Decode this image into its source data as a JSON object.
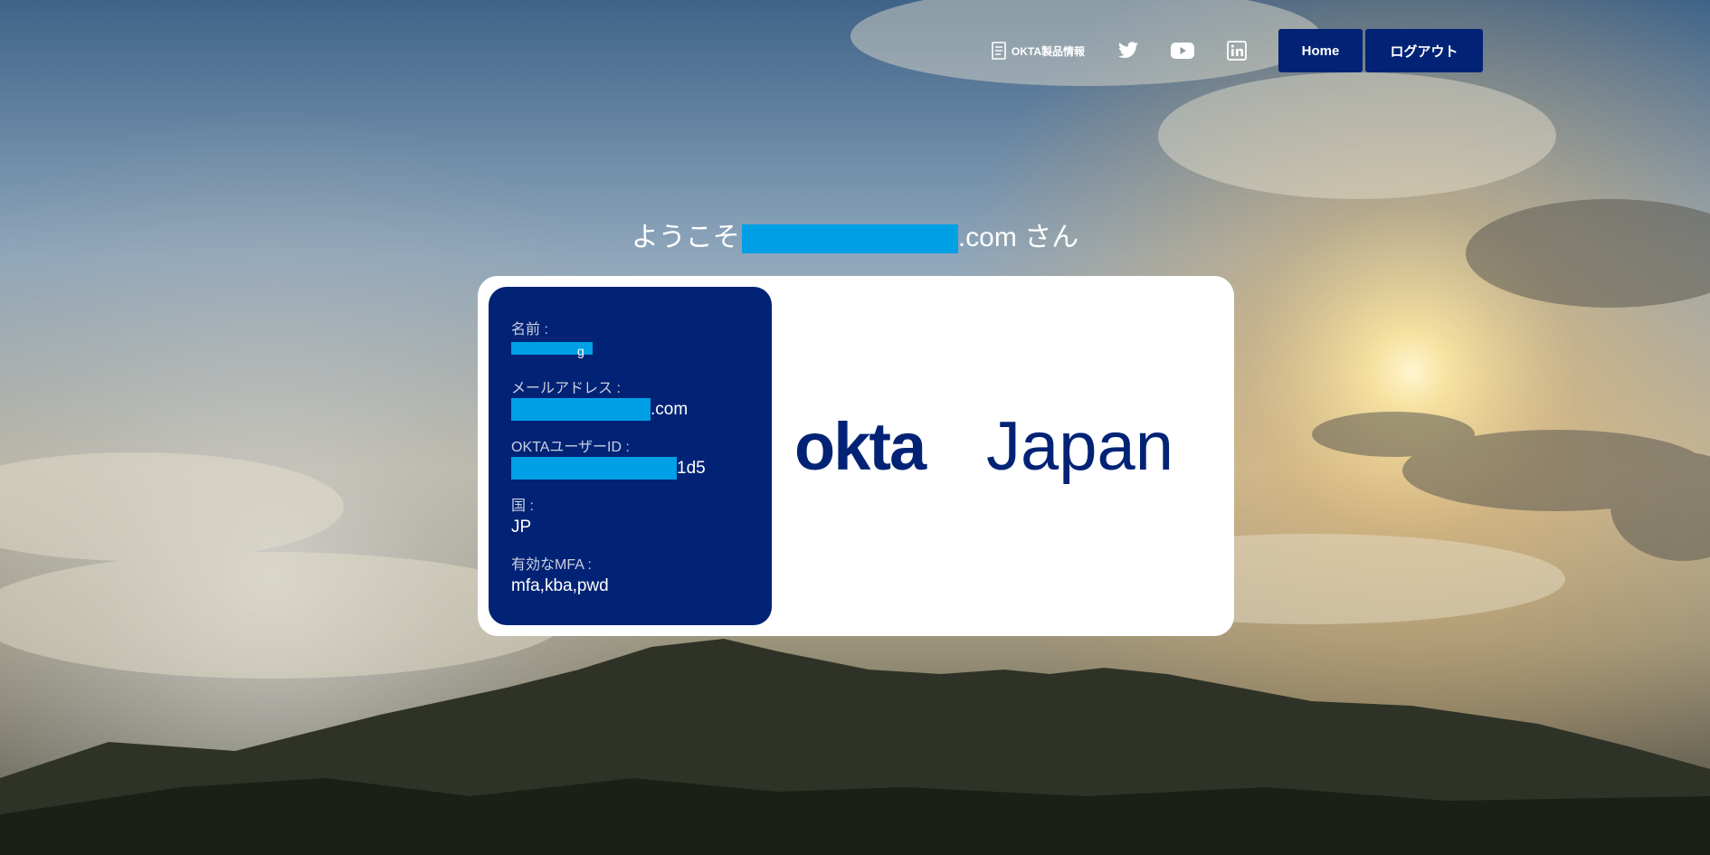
{
  "nav": {
    "product_info_label": "OKTA製品情報",
    "home_label": "Home",
    "logout_label": "ログアウト",
    "social_icons": [
      "twitter-icon",
      "youtube-icon",
      "linkedin-icon"
    ]
  },
  "welcome": {
    "prefix": "ようこそ",
    "domain_suffix": ".com",
    "suffix": " さん"
  },
  "profile": {
    "name_label": "名前 :",
    "name_value": "g",
    "email_label": "メールアドレス :",
    "email_value": ".com",
    "userid_label": "OKTAユーザーID :",
    "userid_value": "1d5",
    "country_label": "国 :",
    "country_value": "JP",
    "mfa_label": "有効なMFA :",
    "mfa_value": "mfa,kba,pwd"
  },
  "logo": {
    "brand": "okta",
    "region": "Japan"
  },
  "colors": {
    "navy": "#022375",
    "redaction": "#00a0e6",
    "white": "#ffffff"
  }
}
